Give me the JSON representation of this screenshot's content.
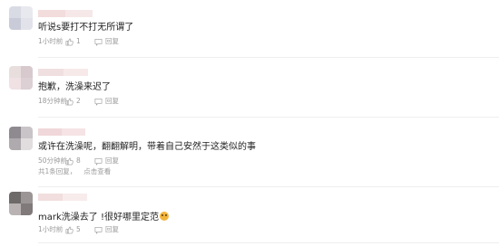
{
  "comments": [
    {
      "text": "听说s要打不打无所谓了",
      "time": "1小时前",
      "likes": "1",
      "reply_label": "回复",
      "avatar_colors": [
        "#d9dbe4",
        "#e8e8ef",
        "#c9ccd8",
        "#e2e3ea"
      ],
      "name_colors": [
        "#f3dcdc",
        "#f6e8e8"
      ]
    },
    {
      "text": "抱歉，洗澡来迟了",
      "time": "18分钟前",
      "likes": "2",
      "reply_label": "回复",
      "avatar_colors": [
        "#e8dede",
        "#d7c9cd",
        "#efe1e4",
        "#dcd0d4"
      ],
      "name_colors": [
        "#f0dfe1",
        "#f7e9ea"
      ]
    },
    {
      "text": "或许在洗澡呢，翻翻解明，带着自己安然于这类似的事",
      "time": "50分钟前",
      "likes": "8",
      "reply_label": "回复",
      "sub_count": "共1条回复，",
      "sub_action": "点击查看",
      "avatar_colors": [
        "#8f8a90",
        "#c9c4c7",
        "#aeaaae",
        "#e1dcde"
      ],
      "name_colors": [
        "#f0d7da",
        "#f5e3e5"
      ]
    },
    {
      "text": "mark洗澡去了 !很好哪里定范",
      "time": "1小时前",
      "likes": "5",
      "reply_label": "回复",
      "avatar_colors": [
        "#6f6a6a",
        "#9b9595",
        "#b9b3b3",
        "#807a7a"
      ],
      "name_colors": [
        "#f2dede",
        "#f8ebeb"
      ]
    }
  ],
  "icons": {
    "like": "thumbs-up-icon",
    "reply": "comment-bubble-icon"
  }
}
